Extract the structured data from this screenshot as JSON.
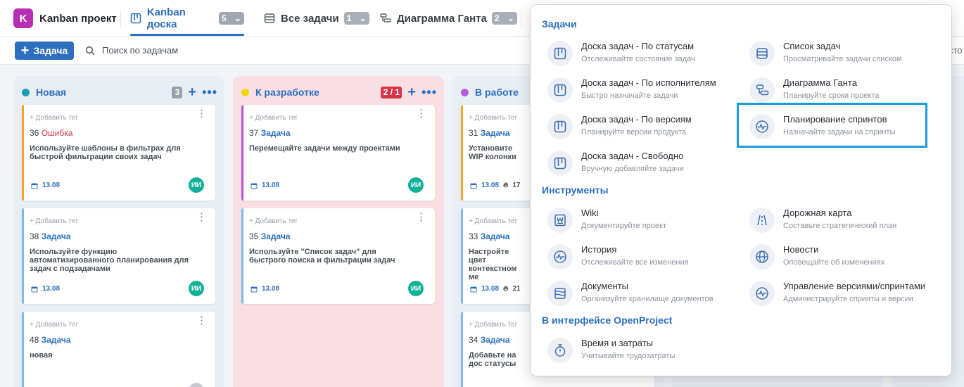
{
  "topbar": {
    "logo_letter": "K",
    "project_name": "Kanban проект",
    "tabs": [
      {
        "label": "Kanban доска",
        "count": "5",
        "icon": "kanban-icon",
        "active": true
      },
      {
        "label": "Все задачи",
        "count": "1",
        "icon": "list-icon",
        "active": false
      },
      {
        "label": "Диаграмма Ганта",
        "count": "2",
        "icon": "gantt-icon",
        "active": false
      }
    ]
  },
  "subbar": {
    "add_label": "Задача",
    "search_placeholder": "Поиск по задачам",
    "right_cut_text": "сто"
  },
  "board": {
    "columns": [
      {
        "title": "Новая",
        "dot_color": "#1a9fb3",
        "count": "3",
        "cards": [
          {
            "add_tag": "+ Добавить тег",
            "number": "36",
            "type": "Ошибка",
            "type_error": true,
            "desc": "Используйте шаблоны в фильтрах для быстрой фильтрации своих задач",
            "date": "13.08",
            "avatar": "ИИ",
            "bar": "#f2a623"
          },
          {
            "add_tag": "+ Добавить тег",
            "number": "38",
            "type": "Задача",
            "desc": "Используйте функцию автоматизированного планирования для задач с подзадачами",
            "date": "13.08",
            "avatar": "ИИ",
            "bar": "#7fb8ee"
          },
          {
            "add_tag": "+ Добавить тег",
            "number": "48",
            "type": "Задача",
            "desc": "новая",
            "date": "",
            "avatar": "",
            "bar": "#7fb8ee"
          }
        ]
      },
      {
        "title": "К разработке",
        "dot_color": "#f2d60c",
        "count": "2 / 1",
        "cards": [
          {
            "add_tag": "+ Добавить тег",
            "number": "37",
            "type": "Задача",
            "desc": "Перемещайте задачи между проектами",
            "date": "13.08",
            "avatar": "ИИ",
            "bar": "#b653d6"
          },
          {
            "add_tag": "+ Добавить тег",
            "number": "35",
            "type": "Задача",
            "desc": "Используйте \"Список задач\" для быстрого поиска и фильтрации задач",
            "date": "13.08",
            "avatar": "ИИ",
            "bar": "#7fb8ee"
          }
        ]
      },
      {
        "title": "В работе",
        "dot_color": "#b65ae0",
        "cards": [
          {
            "add_tag": "+ Добавить тег",
            "number": "31",
            "type": "Задача",
            "desc": "Установите WIP колонки",
            "date": "13.08",
            "extra": "17",
            "bar": "#f2a623"
          },
          {
            "add_tag": "+ Добавить тег",
            "number": "33",
            "type": "Задача",
            "desc": "Настройте цвет контекстном ме",
            "date": "13.08",
            "extra": "21",
            "bar": "#7fb8ee"
          },
          {
            "add_tag": "+ Добавить тег",
            "number": "34",
            "type": "Задача",
            "desc": "Добавьте на дос статусы",
            "date": "",
            "bar": "#7fb8ee"
          }
        ]
      }
    ]
  },
  "menu": {
    "sections": [
      {
        "title": "Задачи"
      },
      {
        "title": "Инструменты"
      },
      {
        "title": "В интерфейсе OpenProject"
      }
    ],
    "tasks_items": [
      {
        "title": "Доска задач - По статусам",
        "subtitle": "Отслеживайте состояние задач",
        "icon": "board-icon"
      },
      {
        "title": "Доска задач - По исполнителям",
        "subtitle": "Быстро назначайте задачи",
        "icon": "board-icon"
      },
      {
        "title": "Доска задач - По версиям",
        "subtitle": "Планируйте версии продукта",
        "icon": "board-icon"
      },
      {
        "title": "Доска задач - Свободно",
        "subtitle": "Вручную добавляйте задачи",
        "icon": "board-icon"
      },
      {
        "title": "Список задач",
        "subtitle": "Просматривайте задачи списком",
        "icon": "list-icon"
      },
      {
        "title": "Диаграмма Ганта",
        "subtitle": "Планируйте сроки проекта",
        "icon": "gantt-icon"
      },
      {
        "title": "Планирование спринтов",
        "subtitle": "Назначайте задачи на спринты",
        "icon": "pulse-icon"
      }
    ],
    "tools_items": [
      {
        "title": "Wiki",
        "subtitle": "Документируйте проект",
        "icon": "wiki-icon"
      },
      {
        "title": "История",
        "subtitle": "Отслеживайте все изменения",
        "icon": "pulse-icon"
      },
      {
        "title": "Документы",
        "subtitle": "Организуйте хранилище документов",
        "icon": "documents-icon"
      },
      {
        "title": "Дорожная карта",
        "subtitle": "Составьте стратегический план",
        "icon": "road-icon"
      },
      {
        "title": "Новости",
        "subtitle": "Оповещайте об изменениях",
        "icon": "globe-icon"
      },
      {
        "title": "Управление версиями/спринтами",
        "subtitle": "Администрируйте спринты и версии",
        "icon": "pulse-icon"
      }
    ],
    "openproject_items": [
      {
        "title": "Время и затраты",
        "subtitle": "Учитывайте трудозатраты",
        "icon": "stopwatch-icon"
      }
    ]
  },
  "colors": {
    "accent": "#2c6fc0",
    "highlight": "#1b9bde",
    "col_new_bg": "#e9eef5",
    "col_dev_bg": "#f9dfe3"
  }
}
